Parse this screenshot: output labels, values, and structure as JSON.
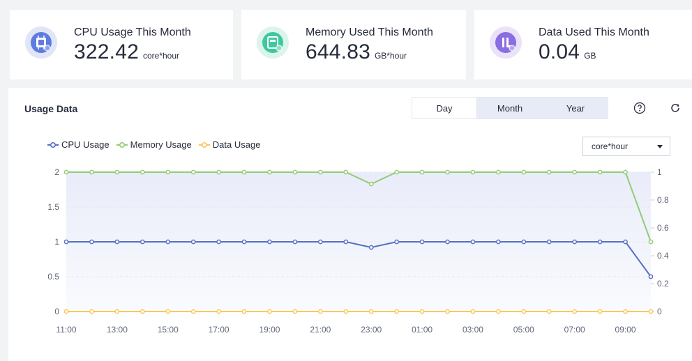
{
  "cards": [
    {
      "title": "CPU Usage This Month",
      "value": "322.42",
      "unit": "core*hour",
      "icon": "cpu-icon",
      "color": "#5e7ce0",
      "bg": "#e0e6f8"
    },
    {
      "title": "Memory Used This Month",
      "value": "644.83",
      "unit": "GB*hour",
      "icon": "memory-icon",
      "color": "#3ec8a0",
      "bg": "#dbf4ec"
    },
    {
      "title": "Data Used This Month",
      "value": "0.04",
      "unit": "GB",
      "icon": "data-icon",
      "color": "#8a6ee0",
      "bg": "#e9e2f8"
    }
  ],
  "panel": {
    "title": "Usage Data",
    "tabs": [
      "Day",
      "Month",
      "Year"
    ],
    "selected_tab": "Month",
    "unit_select": "core*hour"
  },
  "chart_data": {
    "type": "line",
    "x": [
      "11:00",
      "12:00",
      "13:00",
      "14:00",
      "15:00",
      "16:00",
      "17:00",
      "18:00",
      "19:00",
      "20:00",
      "21:00",
      "22:00",
      "23:00",
      "00:00",
      "01:00",
      "02:00",
      "03:00",
      "04:00",
      "05:00",
      "06:00",
      "07:00",
      "08:00",
      "09:00",
      "10:00"
    ],
    "x_tick_labels": [
      "11:00",
      "13:00",
      "15:00",
      "17:00",
      "19:00",
      "21:00",
      "23:00",
      "01:00",
      "03:00",
      "05:00",
      "07:00",
      "09:00"
    ],
    "series": [
      {
        "name": "CPU Usage",
        "color": "#5470c6",
        "axis": "left",
        "values": [
          1,
          1,
          1,
          1,
          1,
          1,
          1,
          1,
          1,
          1,
          1,
          1,
          0.92,
          1,
          1,
          1,
          1,
          1,
          1,
          1,
          1,
          1,
          1,
          0.5
        ]
      },
      {
        "name": "Memory Usage",
        "color": "#91cc75",
        "axis": "left",
        "values": [
          2,
          2,
          2,
          2,
          2,
          2,
          2,
          2,
          2,
          2,
          2,
          2,
          1.83,
          2,
          2,
          2,
          2,
          2,
          2,
          2,
          2,
          2,
          2,
          1
        ]
      },
      {
        "name": "Data Usage",
        "color": "#fac858",
        "axis": "right",
        "values": [
          0,
          0,
          0,
          0,
          0,
          0,
          0,
          0,
          0,
          0,
          0,
          0,
          0,
          0,
          0,
          0,
          0,
          0,
          0,
          0,
          0,
          0,
          0,
          0
        ]
      }
    ],
    "left_ylim": [
      0,
      2
    ],
    "left_ticks": [
      "0",
      "0.5",
      "1",
      "1.5",
      "2"
    ],
    "right_ylim": [
      0,
      1
    ],
    "right_ticks": [
      "0",
      "0.2",
      "0.4",
      "0.6",
      "0.8",
      "1"
    ],
    "grid": true,
    "legend": "top-left"
  }
}
